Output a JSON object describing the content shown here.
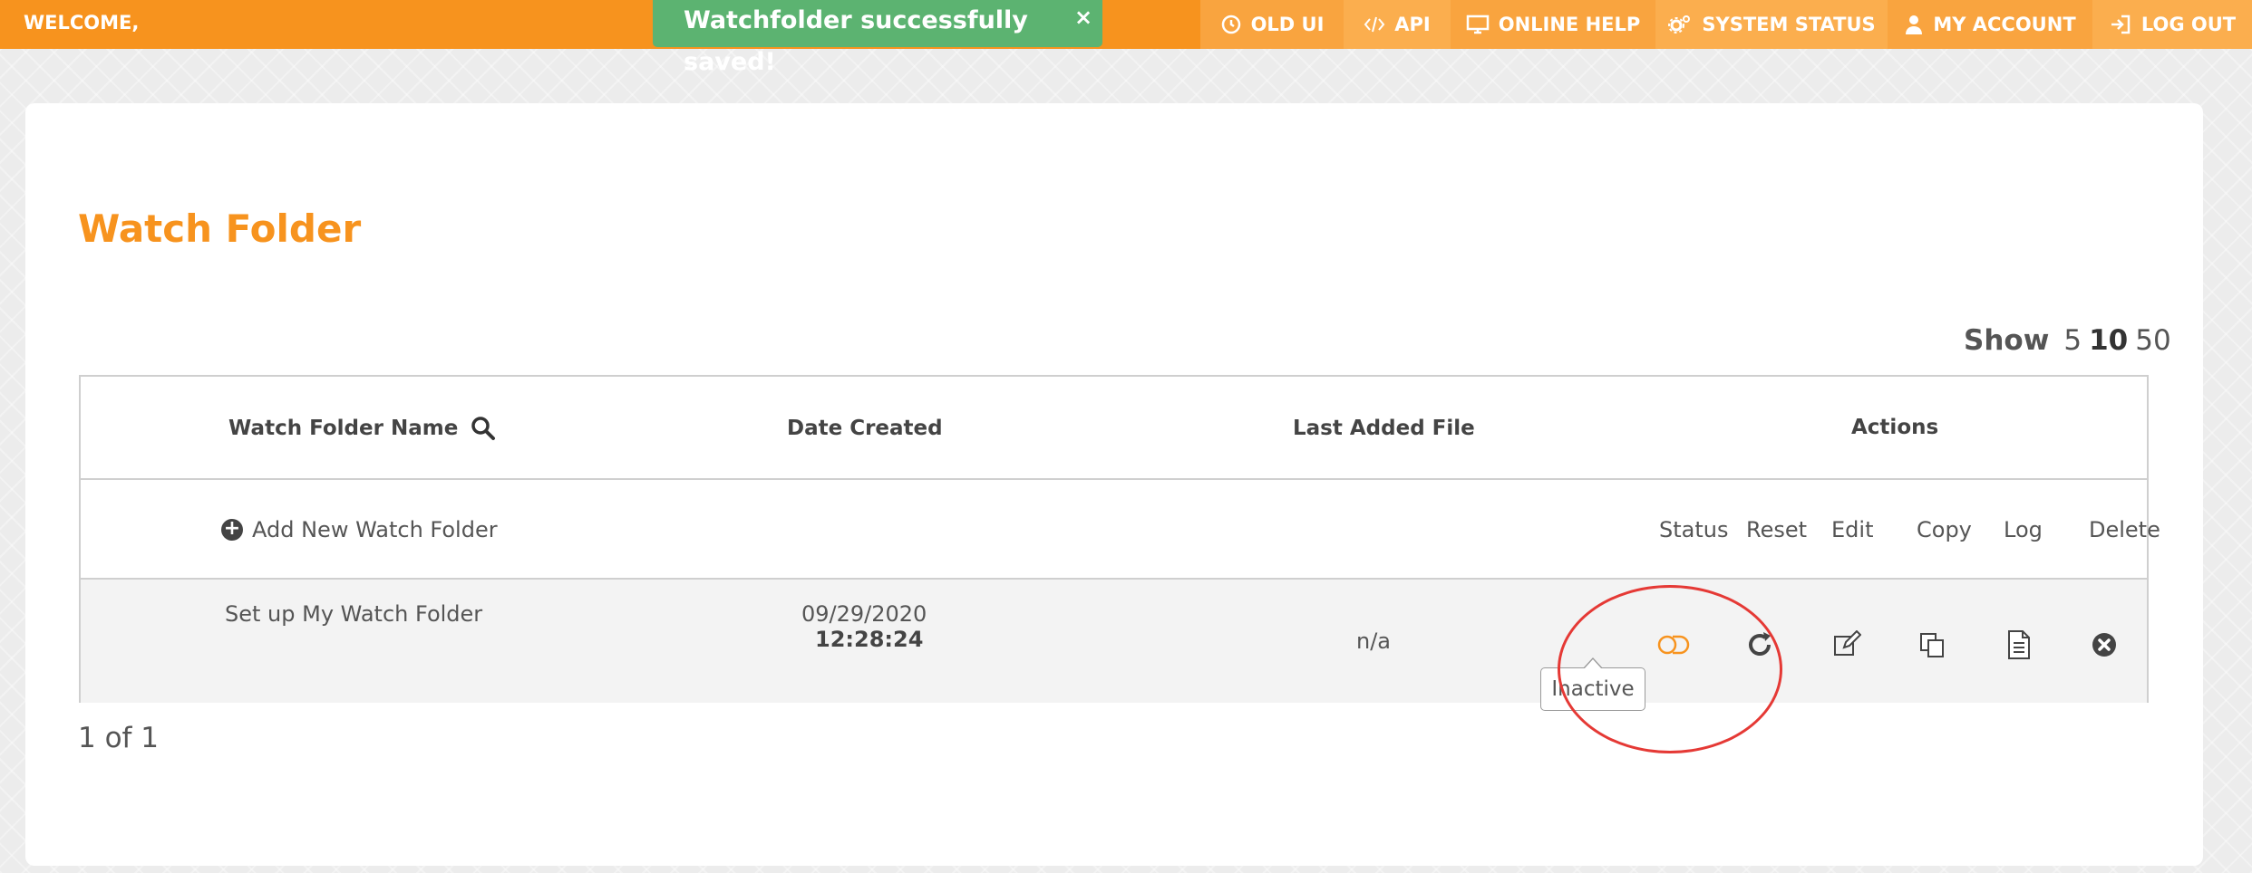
{
  "header": {
    "welcome": "WELCOME,",
    "toast": {
      "message": "Watchfolder successfully saved!",
      "close": "×"
    },
    "nav": [
      {
        "label": "OLD UI",
        "icon": "clock-icon"
      },
      {
        "label": "API",
        "icon": "code-icon"
      },
      {
        "label": "ONLINE HELP",
        "icon": "monitor-icon"
      },
      {
        "label": "SYSTEM STATUS",
        "icon": "gears-icon"
      },
      {
        "label": "MY ACCOUNT",
        "icon": "user-icon"
      },
      {
        "label": "LOG OUT",
        "icon": "logout-icon"
      }
    ]
  },
  "page": {
    "title": "Watch Folder",
    "show": {
      "label": "Show",
      "options": [
        "5",
        "10",
        "50"
      ],
      "selected": "10"
    }
  },
  "table": {
    "headers": {
      "name": "Watch Folder Name",
      "date": "Date Created",
      "last_file": "Last Added File",
      "actions": "Actions"
    },
    "add_label": "Add New Watch Folder",
    "action_labels": [
      "Status",
      "Reset",
      "Edit",
      "Copy",
      "Log",
      "Delete"
    ],
    "rows": [
      {
        "name": "Set up My Watch Folder",
        "date": "09/29/2020",
        "time": "12:28:24",
        "last_file": "n/a",
        "status": "Inactive"
      }
    ]
  },
  "pagination": "1 of 1",
  "colors": {
    "brand": "#f7931e",
    "success": "#5cb371",
    "highlight": "#e53935"
  }
}
